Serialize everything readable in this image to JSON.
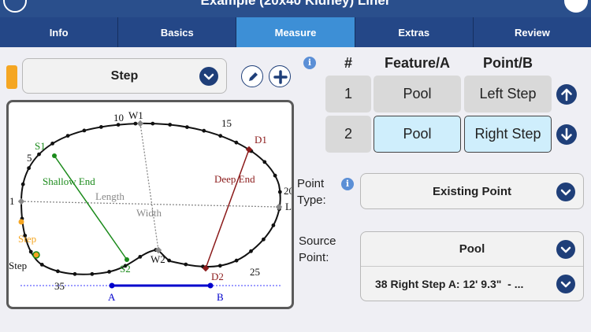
{
  "header": {
    "title": "Example (20x40 Kidney) Liner"
  },
  "tabs": [
    {
      "label": "Info"
    },
    {
      "label": "Basics"
    },
    {
      "label": "Measure",
      "active": true
    },
    {
      "label": "Extras"
    },
    {
      "label": "Review"
    }
  ],
  "feature_select": {
    "value": "Step"
  },
  "table": {
    "headers": {
      "num": "#",
      "feature": "Feature/A",
      "point": "Point/B"
    },
    "rows": [
      {
        "num": "1",
        "feature": "Pool",
        "point": "Left Step"
      },
      {
        "num": "2",
        "feature": "Pool",
        "point": "Right Step"
      }
    ]
  },
  "point_type": {
    "label": "Point Type:",
    "value": "Existing Point"
  },
  "source_point": {
    "label": "Source Point:",
    "value": "Pool",
    "detail": "38 Right Step A: 12' 9.3\"  - ..."
  },
  "diagram": {
    "labels": {
      "w1": "W1",
      "w2": "W2",
      "s1": "S1",
      "s2": "S2",
      "d1": "D1",
      "d2": "D2",
      "shallow": "Shallow End",
      "deep": "Deep End",
      "length": "Length",
      "width": "Width",
      "step_orange": "Step",
      "step_black": "Step",
      "a": "A",
      "b": "B",
      "n10": "10",
      "n15": "15",
      "n5": "5",
      "n20": "20",
      "n25": "25",
      "n35": "35",
      "n1": "1",
      "l": "L"
    }
  },
  "colors": {
    "accent": "#1f3f79",
    "active_tab": "#3d8fd6",
    "orange": "#f5a623",
    "green": "#1a8a1a",
    "red": "#8b1a1a",
    "blue": "#0000cc"
  }
}
